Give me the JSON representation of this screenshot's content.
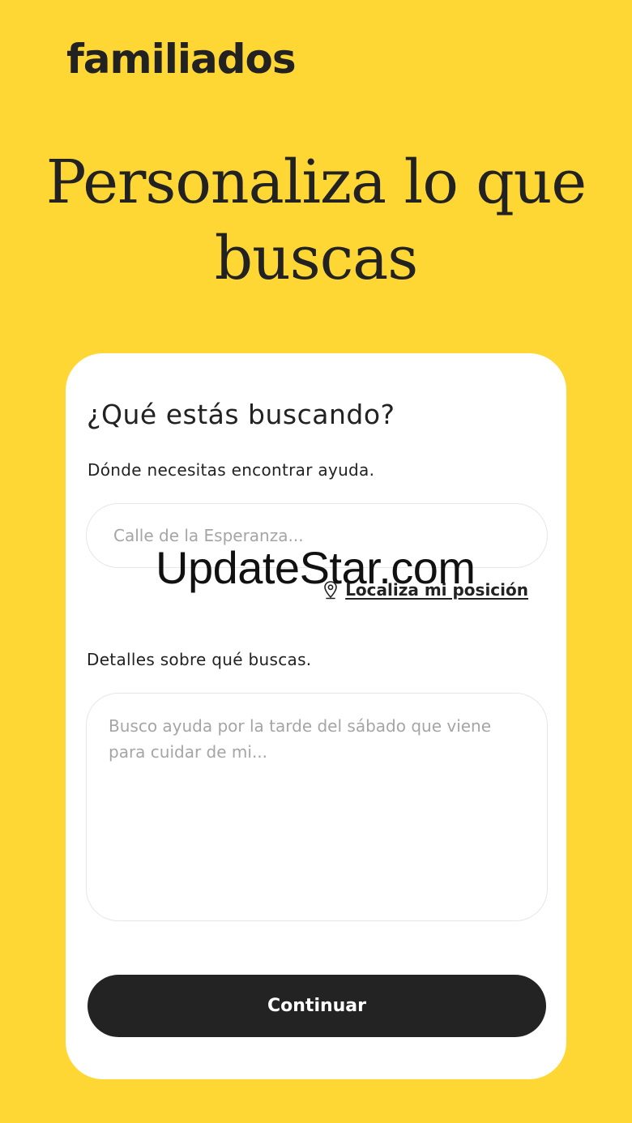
{
  "brand": {
    "logo_text": "familiados"
  },
  "headline": "Personaliza lo que buscas",
  "form": {
    "title": "¿Qué estás buscando?",
    "location_label": "Dónde necesitas encontrar ayuda.",
    "location_placeholder": "Calle de la Esperanza...",
    "location_value": "",
    "locate_link": "Localiza mi posición",
    "details_label": "Detalles sobre qué buscas.",
    "details_placeholder": "Busco ayuda por la tarde del sábado que viene para cuidar de mi...",
    "details_value": "",
    "submit_label": "Continuar"
  },
  "watermark": "UpdateStar.com",
  "icons": {
    "locate": "map-pin-icon"
  },
  "colors": {
    "background": "#FFD735",
    "card": "#FFFFFF",
    "button": "#232323",
    "text": "#222222"
  }
}
